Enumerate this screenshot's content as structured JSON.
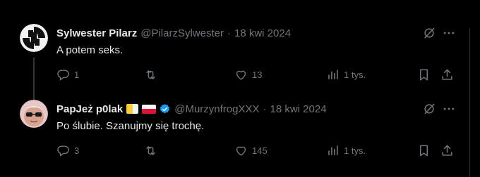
{
  "tweets": [
    {
      "author_name": "Sylwester Pilarz",
      "author_handle": "@PilarzSylwester",
      "separator": "·",
      "date": "18 kwi 2024",
      "text": "A potem seks.",
      "replies": "1",
      "retweets": "",
      "likes": "13",
      "views": "1 tys."
    },
    {
      "author_name": "PapJeż p0lak",
      "author_handle": "@MurzynfrogXXX",
      "separator": "·",
      "date": "18 kwi 2024",
      "text": "Po ślubie. Szanujmy się trochę.",
      "replies": "3",
      "retweets": "",
      "likes": "145",
      "views": "1 tys."
    }
  ],
  "icons": {
    "reply": "reply-icon",
    "retweet": "retweet-icon",
    "like": "heart-icon",
    "views": "views-icon",
    "bookmark": "bookmark-icon",
    "share": "share-icon",
    "grok": "grok-icon",
    "more": "more-icon",
    "verified": "verified-badge-icon"
  },
  "colors": {
    "background": "#000000",
    "text": "#e7e9ea",
    "muted": "#71767b",
    "verified": "#1d9bf0"
  }
}
